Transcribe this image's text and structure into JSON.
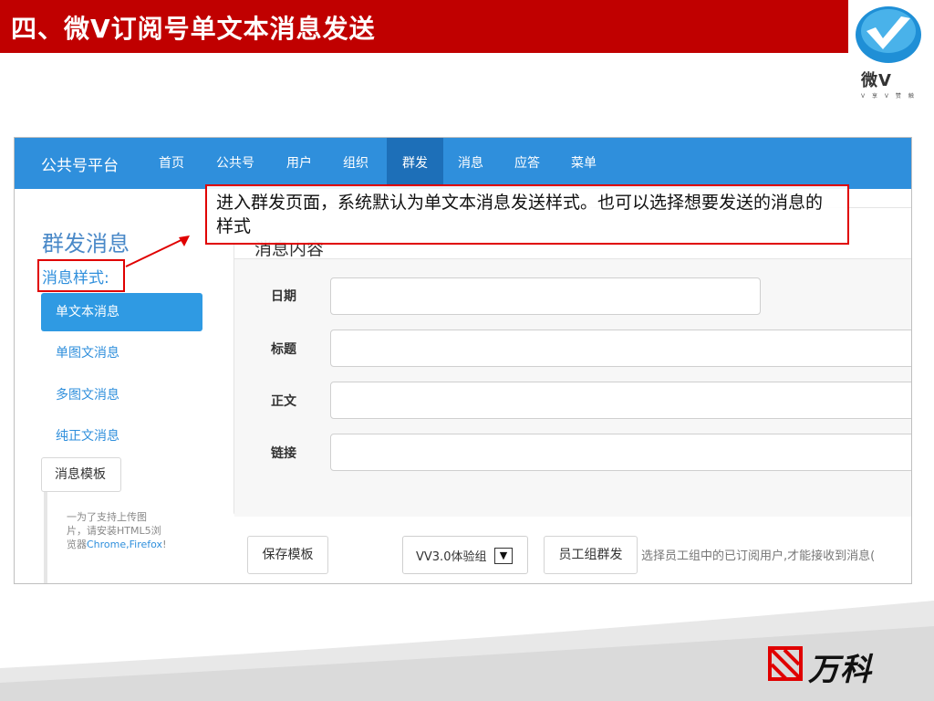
{
  "slide": {
    "title": "四、微V订阅号单文本消息发送",
    "logo_text": "微V",
    "logo_sub": "V 享 V 赞 触"
  },
  "navbar": {
    "brand": "公共号平台",
    "items": [
      {
        "label": "首页",
        "active": false
      },
      {
        "label": "公共号",
        "active": false
      },
      {
        "label": "用户",
        "active": false
      },
      {
        "label": "组织",
        "active": false
      },
      {
        "label": "群发",
        "active": true
      },
      {
        "label": "消息",
        "active": false
      },
      {
        "label": "应答",
        "active": false
      },
      {
        "label": "菜单",
        "active": false
      }
    ]
  },
  "sidebar": {
    "title": "群发消息",
    "style_label": "消息样式:",
    "items": [
      {
        "label": "单文本消息",
        "active": true
      },
      {
        "label": "单图文消息",
        "active": false
      },
      {
        "label": "多图文消息",
        "active": false
      },
      {
        "label": "纯正文消息",
        "active": false
      }
    ],
    "template_button": "消息模板",
    "hint_line1": "一为了支持上传图",
    "hint_line2": "片，请安装HTML5浏",
    "hint_line3_prefix": "览器",
    "hint_browsers": "Chrome,Firefox",
    "hint_line3_suffix": "!"
  },
  "panel": {
    "title": "消息内容",
    "fields": {
      "date": {
        "label": "日期",
        "value": ""
      },
      "title": {
        "label": "标题",
        "value": ""
      },
      "body": {
        "label": "正文",
        "value": ""
      },
      "link": {
        "label": "链接",
        "value": ""
      }
    }
  },
  "bottom": {
    "save_template": "保存模板",
    "group_select_value": "VV3.0体验组",
    "group_send": "员工组群发",
    "hint": "选择员工组中的已订阅用户,才能接收到消息("
  },
  "callout": {
    "text": "进入群发页面，系统默认为单文本消息发送样式。也可以选择想要发送的消息的样式"
  },
  "footer": {
    "brand_text": "万科"
  },
  "colors": {
    "title_bar": "#c00000",
    "navbar": "#2f8fdc",
    "nav_active": "#1d6fb8",
    "highlight": "#e00000"
  }
}
